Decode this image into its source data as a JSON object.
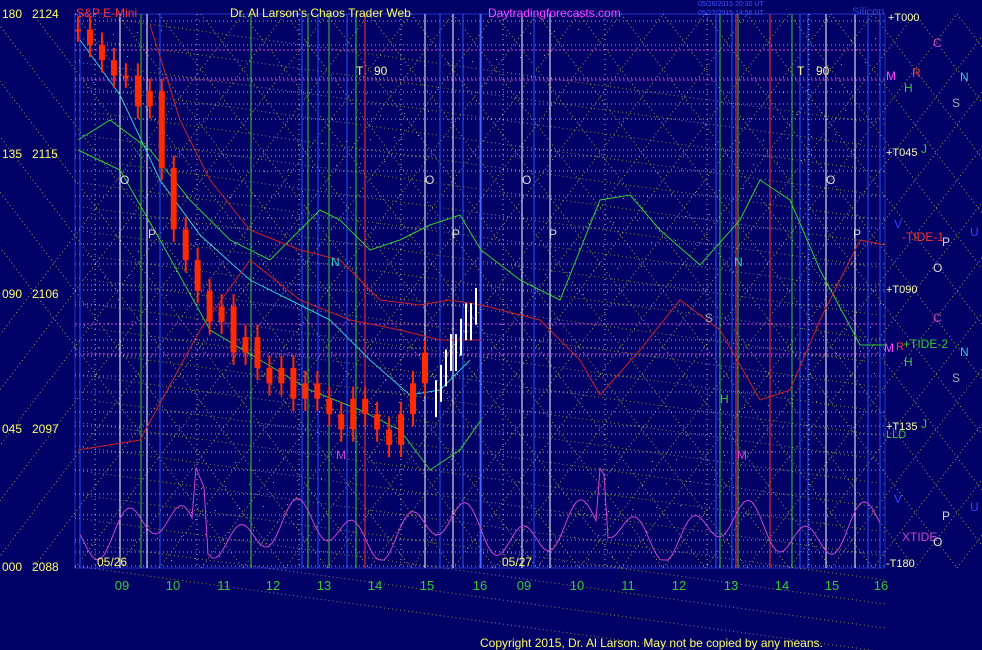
{
  "header": {
    "instrument": "S&P E-Mini",
    "title": "Dr. Al Larson's Chaos Trader Web",
    "site": "Daytradingforecasts.com",
    "stamp1": "05/26/2015 20:30 UT",
    "stamp2": "05/27/2015 14:56 UT",
    "corner": "Silicon"
  },
  "footer": {
    "copyright": "Copyright 2015, Dr. Al Larson. May not be copied by any means."
  },
  "colors": {
    "background": "#000066",
    "price_candle": "#ff2a00",
    "price_new": "#ffffff",
    "grid_yellow": "#e8e83a",
    "oscillator": "#cc44cc",
    "cyan_line": "#33cccc",
    "green_line": "#33cc33",
    "red_line": "#cc2222"
  },
  "left_labels": [
    {
      "angle": "180",
      "price": "2124"
    },
    {
      "angle": "135",
      "price": "2115"
    },
    {
      "angle": "090",
      "price": "2106"
    },
    {
      "angle": "045",
      "price": "2097"
    },
    {
      "angle": "000",
      "price": "2088"
    }
  ],
  "day_labels": [
    "05/26",
    "05/27"
  ],
  "chart_markers": {
    "t90": [
      "T",
      "90"
    ],
    "flux": [
      "O",
      "P",
      "N",
      "M",
      "S",
      "H"
    ]
  },
  "right_labels": {
    "t000": "+T000",
    "t045": "+T045",
    "t090": "+T090",
    "t135": "+T135",
    "t180": "-T180",
    "tide1": "-TIDE-1",
    "tide2": "+TIDE-2",
    "xtide": "XTIDE",
    "lld": "LLD",
    "letters": [
      "C",
      "R",
      "M",
      "N",
      "H",
      "S",
      "P",
      "O",
      "V",
      "U",
      "J"
    ]
  },
  "chart_data": {
    "type": "line",
    "xlabel": "",
    "ylabel": "",
    "x_ticks": [
      "09",
      "10",
      "11",
      "12",
      "13",
      "14",
      "15",
      "16",
      "09",
      "10",
      "11",
      "12",
      "13",
      "14",
      "15",
      "16"
    ],
    "ylim": [
      2088,
      2124
    ],
    "y_ticks": [
      2088,
      2097,
      2106,
      2115,
      2124
    ],
    "series": [
      {
        "values": [
          2123,
          2122,
          2121,
          2120,
          2120,
          2118,
          2119,
          2114,
          2110,
          2108,
          2106,
          2104,
          2105,
          2102,
          2103,
          2101,
          2100,
          2101,
          2099,
          2100,
          2099,
          2098,
          2097,
          2099,
          2098,
          2097,
          2096,
          2098,
          2100,
          2102
        ]
      }
    ]
  }
}
